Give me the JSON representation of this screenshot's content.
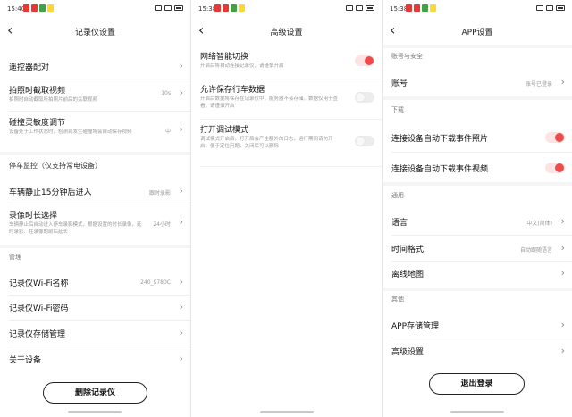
{
  "panels": [
    {
      "status": {
        "time": "15:40"
      },
      "title": "记录仪设置",
      "rows": {
        "remote": {
          "label": "遥控器配对"
        },
        "video": {
          "label": "拍照时截取视频",
          "desc": "拍照时自动截取所拍照片前后的关联视频",
          "value": "10s"
        },
        "collision": {
          "label": "碰撞灵敏度调节",
          "desc": "设备处于工作状态时，检测到发生碰撞将会自动保存视频",
          "value": "中"
        },
        "parking_section": "停车监控（仅支持常电设备）",
        "parking_enter": {
          "label": "车辆静止15分钟后进入",
          "value": "跟时录影"
        },
        "duration": {
          "label": "录像时长选择",
          "desc": "车辆静止后自动进入停车录影模式，根据设置的时长录像，延时录影、在录像的前后延长",
          "value": "24小时"
        },
        "manage_section": "管理",
        "wifi_name": {
          "label": "记录仪Wi-Fi名称",
          "value": "240_9780C"
        },
        "wifi_pwd": {
          "label": "记录仪Wi-Fi密码"
        },
        "storage": {
          "label": "记录仪存储管理"
        },
        "about": {
          "label": "关于设备"
        },
        "delete_btn": "删除记录仪"
      }
    },
    {
      "status": {
        "time": "15:38"
      },
      "title": "高级设置",
      "rows": {
        "network": {
          "label": "网络智能切换",
          "desc": "开启后将自动连接记录仪，请谨慎开启",
          "toggle": true
        },
        "save_data": {
          "label": "允许保存行车数据",
          "desc": "开启后数据将保存在记录仪中，服务器不会存储，数据仅用于查看，请谨慎开启",
          "toggle": false
        },
        "debug": {
          "label": "打开调试模式",
          "desc": "调试模式开启后，打开后会产生额外的日志，运行期间请勿开启，便于定位问题，关闭后可以删除",
          "toggle": false
        }
      }
    },
    {
      "status": {
        "time": "15:38"
      },
      "title": "APP设置",
      "rows": {
        "account_section": "账号与安全",
        "account": {
          "label": "账号",
          "value": "账号已登录"
        },
        "download_section": "下载",
        "auto_photo": {
          "label": "连接设备自动下载事件照片",
          "toggle": true
        },
        "auto_video": {
          "label": "连接设备自动下载事件视频",
          "toggle": true
        },
        "general_section": "通用",
        "language": {
          "label": "语言",
          "value": "中文(简体)"
        },
        "time_format": {
          "label": "时间格式",
          "value": "自动跟随语言"
        },
        "offline_map": {
          "label": "离线地图"
        },
        "other_section": "其他",
        "app_storage": {
          "label": "APP存储管理"
        },
        "advanced": {
          "label": "高级设置"
        },
        "logout_btn": "退出登录"
      }
    }
  ],
  "colors": {
    "accent": "#ee4b4b",
    "track_on": "#fde3e3",
    "track_off": "#ececec"
  }
}
